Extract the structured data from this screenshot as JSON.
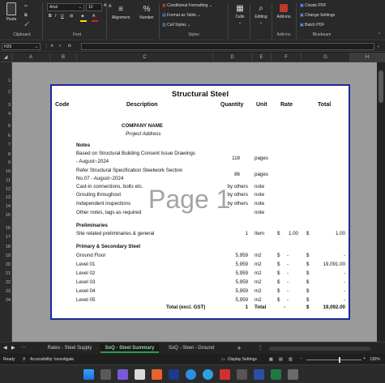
{
  "ribbon": {
    "paste_label": "Paste",
    "clipboard_label": "Clipboard",
    "font_name": "Arial",
    "font_size": "10",
    "font_label": "Font",
    "alignment_label": "Alignment",
    "number_label": "Number",
    "conditional_formatting": "Conditional Formatting",
    "format_as_table": "Format as Table",
    "cell_styles": "Cell Styles",
    "styles_label": "Styles",
    "cells_label": "Cells",
    "editing_label": "Editing",
    "addins_button": "Add-ins",
    "addins_label": "Add-ins",
    "create_pdf": "Create PDF",
    "change_settings": "Change Settings",
    "batch_pdf": "Batch PDF",
    "bluebeam_label": "Bluebeam"
  },
  "formula_bar": {
    "name_box": "H29",
    "fx": "fx",
    "value": ""
  },
  "columns": [
    "A",
    "B",
    "C",
    "D",
    "E",
    "F",
    "G",
    "H"
  ],
  "rows": [
    "1",
    "2",
    "3",
    "4",
    "5",
    "6",
    "7",
    "8",
    "9",
    "10",
    "11",
    "12",
    "13",
    "14",
    "15",
    "16",
    "17",
    "18",
    "19",
    "20",
    "21",
    "22",
    "23",
    "24"
  ],
  "sheet": {
    "title": "Structural Steel",
    "headers": {
      "code": "Code",
      "description": "Description",
      "quantity": "Quantity",
      "unit": "Unit",
      "rate": "Rate",
      "total": "Total"
    },
    "company": "COMPANY NAME",
    "address": "Project Address",
    "watermark": "Page 1",
    "notes_heading": "Notes",
    "notes": [
      {
        "desc": "Based on Structural Building Consent Issue Drawings",
        "qty": "118",
        "unit": "pages"
      },
      {
        "desc": "- August~2024",
        "qty": "",
        "unit": ""
      },
      {
        "desc": "Refer Structural Specification Steelwork Section",
        "qty": "86",
        "unit": "pages"
      },
      {
        "desc": "No.07 - August~2024",
        "qty": "",
        "unit": ""
      },
      {
        "desc": "Cast-in connections, bolts etc.",
        "qty": "by others",
        "unit": "note"
      },
      {
        "desc": "Grouting throughout",
        "qty": "by others",
        "unit": "note"
      },
      {
        "desc": "Independent inspections",
        "qty": "by others",
        "unit": "note"
      },
      {
        "desc": "Other notes, tags as required",
        "qty": "",
        "unit": "note"
      }
    ],
    "prelim_heading": "Preliminaries",
    "prelim": {
      "desc": "Site related preliminaries & general",
      "qty": "1",
      "unit": "Item",
      "rate_sym": "$",
      "rate": "1.00",
      "total_sym": "$",
      "total": "1.00"
    },
    "steel_heading": "Primary & Secondary Steel",
    "steel_rows": [
      {
        "desc": "Ground Floor",
        "qty": "5,959",
        "unit": "m2",
        "rate_sym": "$",
        "rate": "-",
        "total_sym": "$",
        "total": "-"
      },
      {
        "desc": "Level 01",
        "qty": "5,959",
        "unit": "m2",
        "rate_sym": "$",
        "rate": "-",
        "total_sym": "$",
        "total": "19,091.00"
      },
      {
        "desc": "Level 02",
        "qty": "5,959",
        "unit": "m2",
        "rate_sym": "$",
        "rate": "-",
        "total_sym": "$",
        "total": "-"
      },
      {
        "desc": "Level 03",
        "qty": "5,959",
        "unit": "m2",
        "rate_sym": "$",
        "rate": "-",
        "total_sym": "$",
        "total": "-"
      },
      {
        "desc": "Level 04",
        "qty": "5,959",
        "unit": "m2",
        "rate_sym": "$",
        "rate": "-",
        "total_sym": "$",
        "total": "-"
      },
      {
        "desc": "Level 05",
        "qty": "5,959",
        "unit": "m2",
        "rate_sym": "$",
        "rate": "-",
        "total_sym": "$",
        "total": "-"
      }
    ],
    "total_row": {
      "label": "Total (excl. GST)",
      "qty": "1",
      "unit": "Total",
      "rate": "-",
      "total_sym": "$",
      "total": "19,092.00"
    }
  },
  "tabs": {
    "items": [
      "Rates - Steel Supply",
      "SoQ - Steel Summary",
      "SoQ - Steel - Ground"
    ],
    "active": "SoQ - Steel Summary",
    "add": "+"
  },
  "status": {
    "ready": "Ready",
    "accessibility": "Accessibility: Investigate",
    "display_settings": "Display Settings",
    "zoom": "130%"
  },
  "colors": {
    "page_border": "#1a2a9a",
    "active_tab_underline": "#2e9a4e",
    "ribbon_bg": "#292929"
  }
}
